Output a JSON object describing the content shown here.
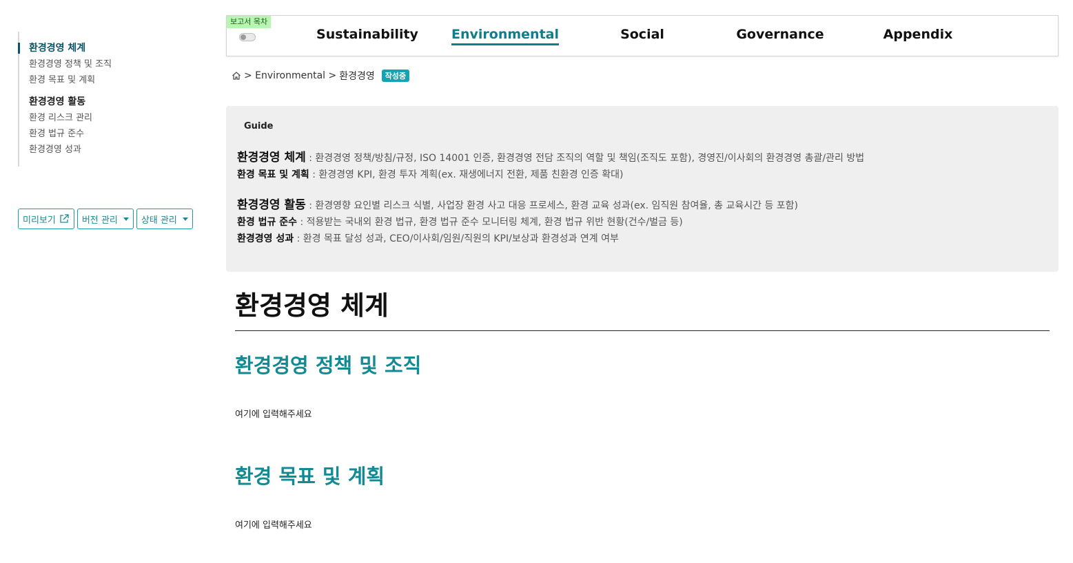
{
  "sidebar": {
    "items": [
      {
        "label": "환경경영 체계"
      },
      {
        "label": "환경경영 정책 및 조직"
      },
      {
        "label": "환경 목표 및 계획"
      },
      {
        "label": "환경경영 활동"
      },
      {
        "label": "환경 리스크 관리"
      },
      {
        "label": "환경 법규 준수"
      },
      {
        "label": "환경경영 성과"
      }
    ],
    "buttons": {
      "preview": "미리보기",
      "version": "버전 관리",
      "status": "상태 관리"
    }
  },
  "topnav": {
    "toc_badge": "보고서 목차",
    "items": [
      {
        "label": "Sustainability"
      },
      {
        "label": "Environmental"
      },
      {
        "label": "Social"
      },
      {
        "label": "Governance"
      },
      {
        "label": "Appendix"
      }
    ]
  },
  "breadcrumb": {
    "section": "> Environmental >",
    "page": "환경경영",
    "status": "작성중"
  },
  "guide": {
    "title": "Guide",
    "lines": [
      {
        "term": "환경경영 체계",
        "desc": " : 환경경영 정책/방침/규정, ISO 14001 인증, 환경경영 전담 조직의 역할 및 책임(조직도 포함), 경영진/이사회의 환경경영 총괄/관리 방법"
      },
      {
        "term": "환경 목표 및 계획",
        "desc": " : 환경경영 KPI, 환경 투자 계획(ex. 재생에너지 전환, 제품 친환경 인증 확대)"
      },
      {
        "term": "환경경영 활동",
        "desc": " : 환경영향 요인별 리스크 식별, 사업장 환경 사고 대응 프로세스, 환경 교육 성과(ex. 임직원 참여율, 총 교육시간 등 포함)"
      },
      {
        "term": "환경 법규 준수",
        "desc": " : 적용받는 국내외 환경 법규, 환경 법규 준수 모니터링 체계, 환경 법규 위반 현황(건수/벌금 등)"
      },
      {
        "term": "환경경영 성과",
        "desc": " : 환경 목표 달성 성과, CEO/이사회/임원/직원의 KPI/보상과 환경성과 연계 여부"
      }
    ]
  },
  "content": {
    "title": "환경경영 체계",
    "sections": [
      {
        "heading": "환경경영 정책 및 조직",
        "placeholder": "여기에 입력해주세요"
      },
      {
        "heading": "환경 목표 및 계획",
        "placeholder": "여기에 입력해주세요"
      }
    ]
  },
  "colors": {
    "accent": "#0f7e8c",
    "heading_teal": "#128a94",
    "badge_green": "#b7f5b0",
    "status_badge": "#15a3b4"
  }
}
